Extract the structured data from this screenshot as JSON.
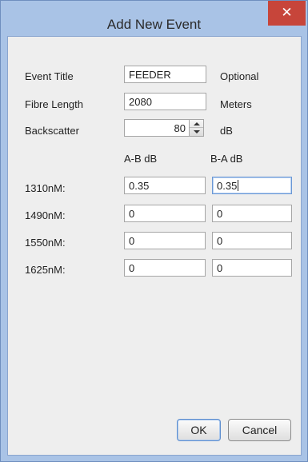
{
  "dialog": {
    "title": "Add New Event"
  },
  "form": {
    "event_title": {
      "label": "Event Title",
      "value": "FEEDER",
      "hint": "Optional"
    },
    "fibre_length": {
      "label": "Fibre Length",
      "value": "2080",
      "unit": "Meters"
    },
    "backscatter": {
      "label": "Backscatter",
      "value": "80",
      "unit": "dB"
    }
  },
  "loss_table": {
    "col_ab": "A-B dB",
    "col_ba": "B-A dB",
    "rows": [
      {
        "label": "1310nM:",
        "ab": "0.35",
        "ba": "0.35"
      },
      {
        "label": "1490nM:",
        "ab": "0",
        "ba": "0"
      },
      {
        "label": "1550nM:",
        "ab": "0",
        "ba": "0"
      },
      {
        "label": "1625nM:",
        "ab": "0",
        "ba": "0"
      }
    ]
  },
  "buttons": {
    "ok": "OK",
    "cancel": "Cancel"
  },
  "colors": {
    "frame": "#a9c3e6",
    "close": "#c7453a",
    "client": "#eeeeee"
  },
  "icons": {
    "close": "close-icon",
    "spin_up": "chevron-up-icon",
    "spin_down": "chevron-down-icon"
  }
}
